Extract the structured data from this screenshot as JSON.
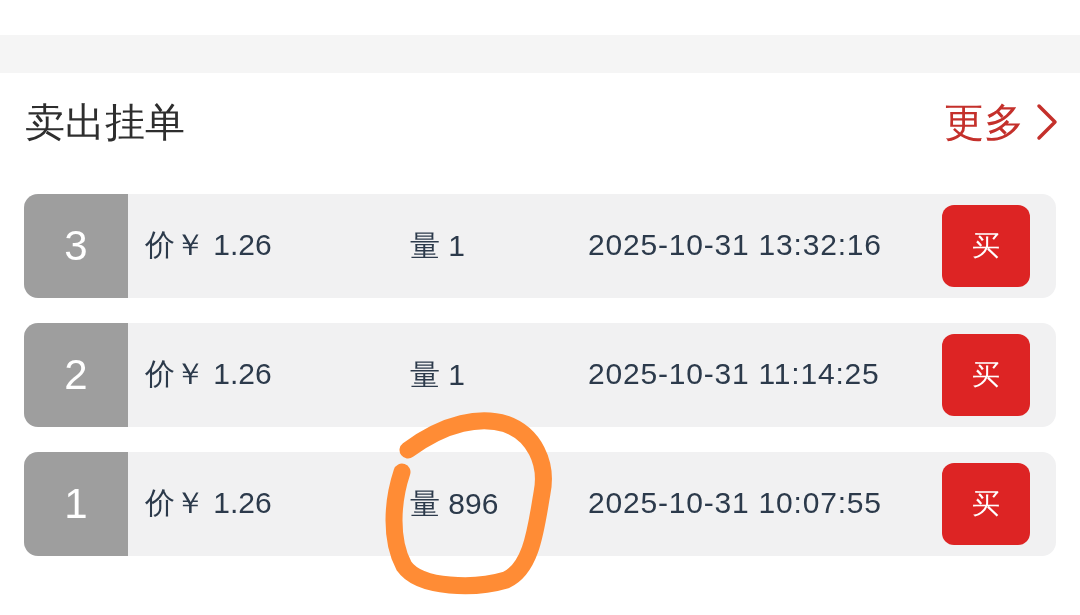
{
  "section": {
    "title": "卖出挂单",
    "more_link": {
      "label": "更多"
    }
  },
  "orders": [
    {
      "rank": "3",
      "price": "价￥ 1.26",
      "quantity": "量 1",
      "time": "2025-10-31 13:32:16",
      "button": "买",
      "circled": false
    },
    {
      "rank": "2",
      "price": "价￥ 1.26",
      "quantity": "量 1",
      "time": "2025-10-31 11:14:25",
      "button": "买",
      "circled": false
    },
    {
      "rank": "1",
      "price": "价￥ 1.26",
      "quantity": "量 896",
      "time": "2025-10-31 10:07:55",
      "button": "买",
      "circled": true
    }
  ]
}
